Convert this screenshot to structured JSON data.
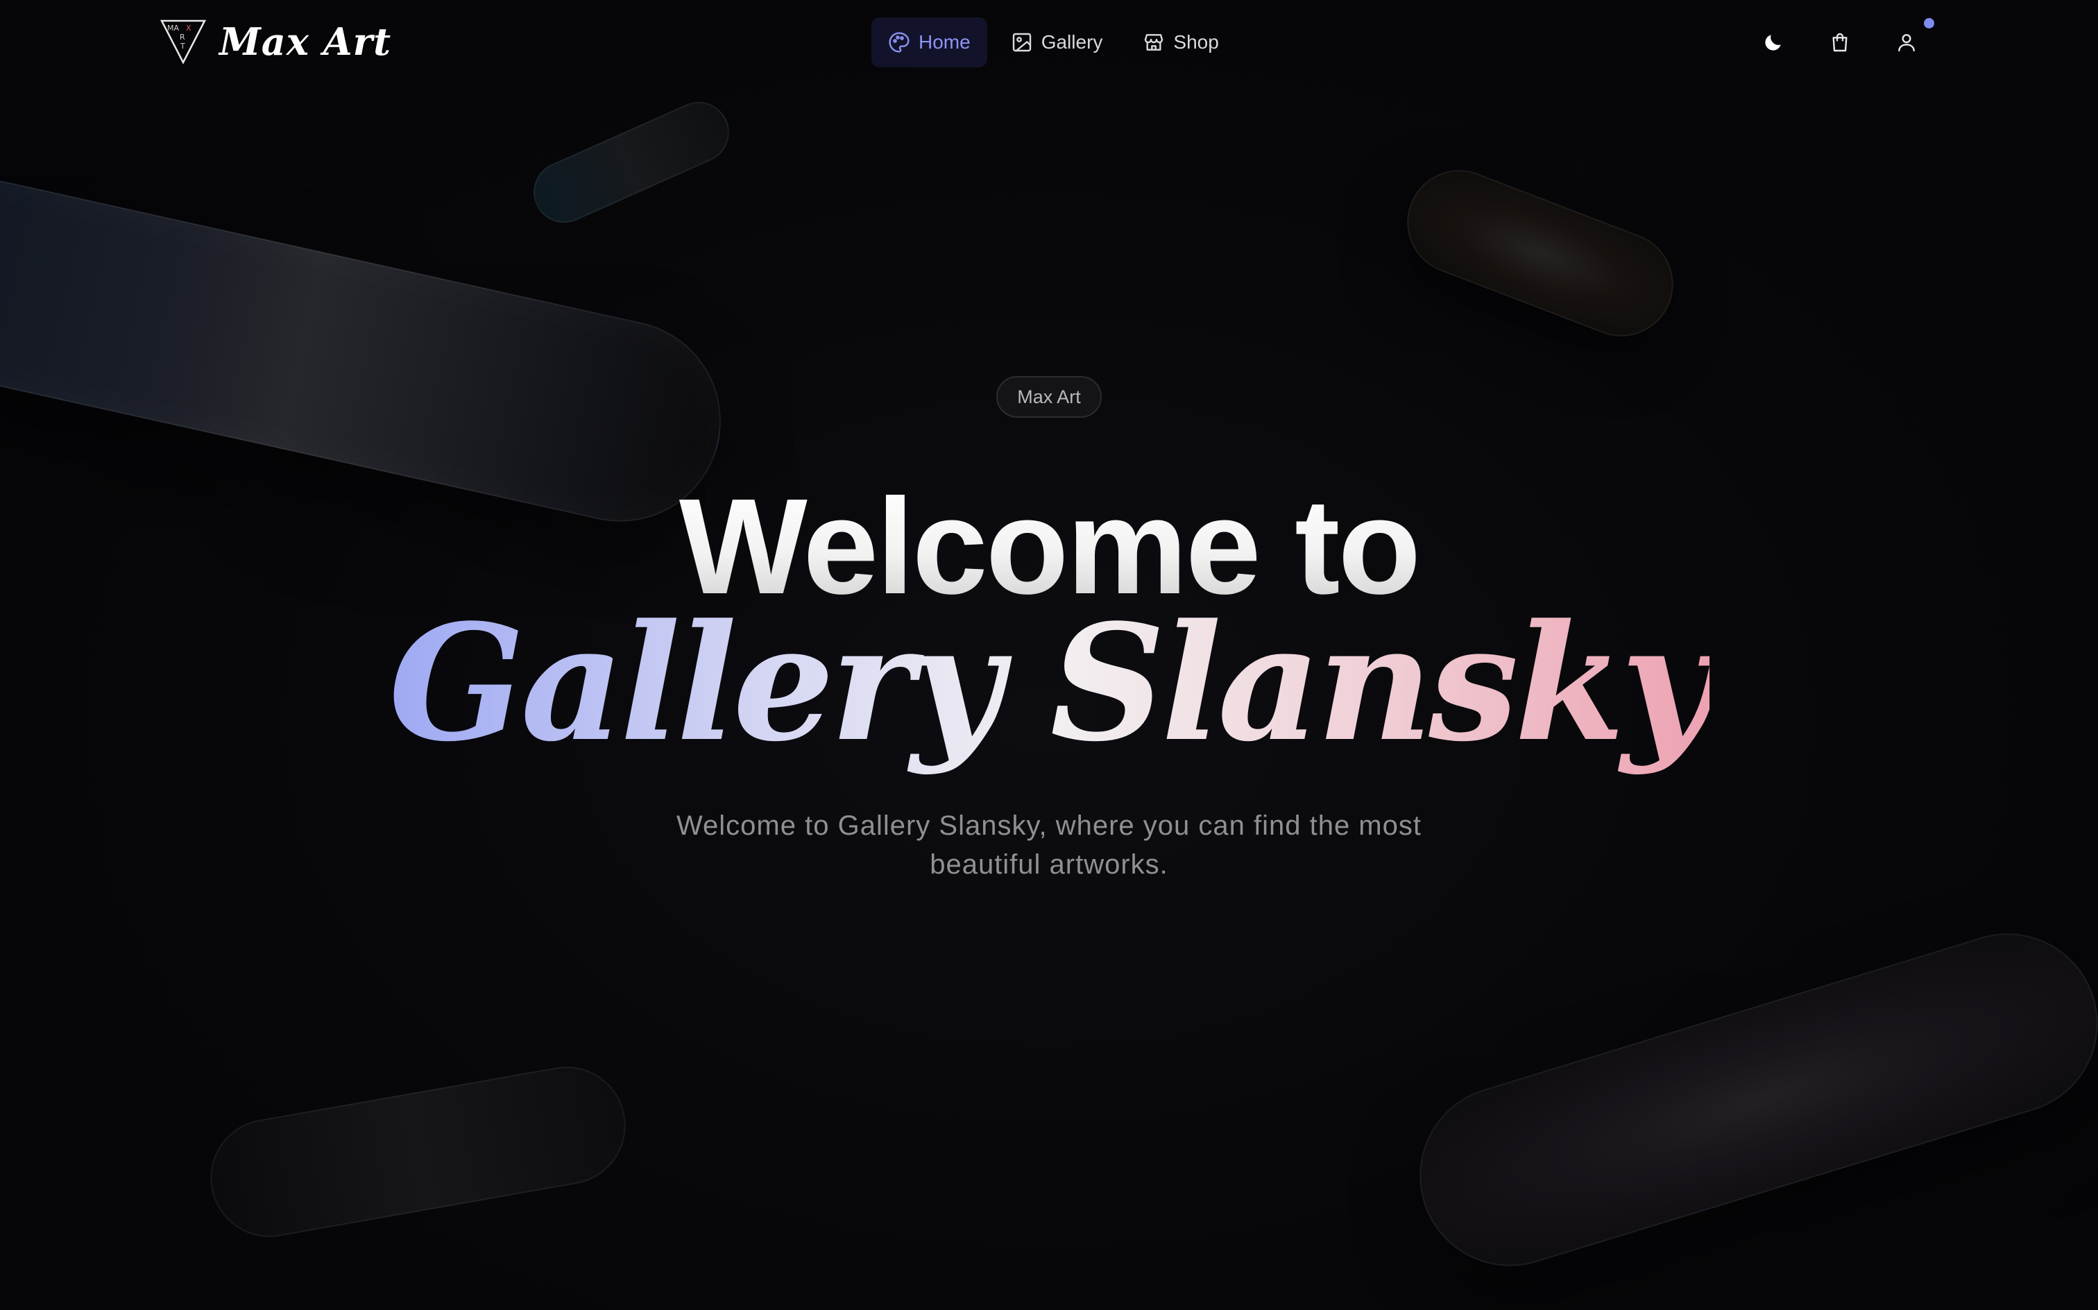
{
  "brand": {
    "name": "Max Art",
    "logo_mark_text": "MAX ART"
  },
  "nav": {
    "items": [
      {
        "label": "Home",
        "icon": "palette-icon",
        "active": true
      },
      {
        "label": "Gallery",
        "icon": "image-icon",
        "active": false
      },
      {
        "label": "Shop",
        "icon": "store-icon",
        "active": false
      }
    ],
    "actions": [
      {
        "icon": "moon-icon",
        "label": "theme toggle"
      },
      {
        "icon": "shopping-bag-icon",
        "label": "cart"
      },
      {
        "icon": "user-icon",
        "label": "account"
      }
    ]
  },
  "hero": {
    "badge": "Max Art",
    "title": "Welcome to",
    "script_title": "Gallery Slansky",
    "subtitle_line1": "Welcome to Gallery Slansky, where you can find the most",
    "subtitle_line2": "beautiful artworks."
  },
  "colors": {
    "background": "#060608",
    "accent": "#8b93f5",
    "active_nav_bg": "#12132a",
    "gradient_start": "#9ea9f3",
    "gradient_end": "#eda2b2",
    "notification_dot": "#7f8cf0"
  }
}
